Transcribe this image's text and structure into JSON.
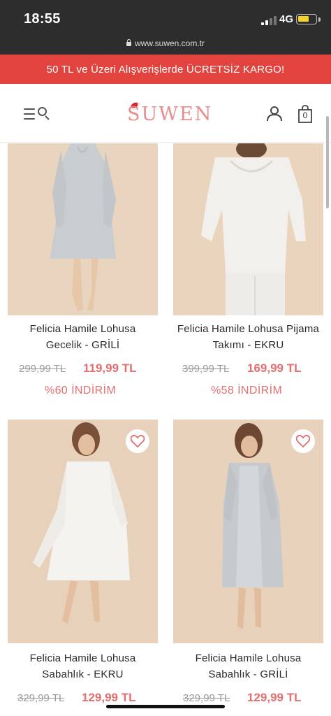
{
  "status_bar": {
    "time": "18:55",
    "network": "4G",
    "url": "www.suwen.com.tr"
  },
  "promo": {
    "text": "50 TL ve Üzeri Alışverişlerde ÜCRETSİZ KARGO!"
  },
  "header": {
    "logo": "SUWEN",
    "cart_count": "0"
  },
  "colors": {
    "promo_bg": "#e2433e",
    "price_accent": "#e46f6f",
    "logo": "#e88e8e"
  },
  "products": [
    {
      "name_line1": "Felicia Hamile Lohusa",
      "name_line2": "Gecelik - GRİLİ",
      "old_price": "299,99 TL",
      "new_price": "119,99 TL",
      "discount": "%60 İNDİRİM"
    },
    {
      "name_line1": "Felicia Hamile Lohusa Pijama",
      "name_line2": "Takımı - EKRU",
      "old_price": "399,99 TL",
      "new_price": "169,99 TL",
      "discount": "%58 İNDİRİM"
    },
    {
      "name_line1": "Felicia Hamile Lohusa",
      "name_line2": "Sabahlık - EKRU",
      "old_price": "329,99 TL",
      "new_price": "129,99 TL",
      "favorite_icon": "heart-icon"
    },
    {
      "name_line1": "Felicia Hamile Lohusa",
      "name_line2": "Sabahlık - GRİLİ",
      "old_price": "329,99 TL",
      "new_price": "129,99 TL",
      "favorite_icon": "heart-icon"
    }
  ]
}
